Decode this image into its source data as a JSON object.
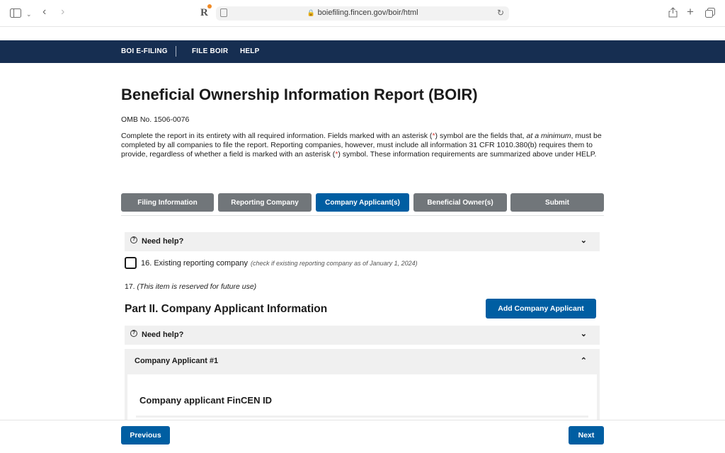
{
  "browser": {
    "url": "boiefiling.fincen.gov/boir/html"
  },
  "nav": {
    "items": [
      "BOI E-FILING",
      "FILE BOIR",
      "HELP"
    ]
  },
  "page": {
    "title": "Beneficial Ownership Information Report (BOIR)",
    "omb": "OMB No. 1506-0076",
    "desc_1": "Complete the report in its entirety with all required information. Fields marked with an asterisk (",
    "asterisk": "*",
    "desc_2": ") symbol are the fields that, ",
    "desc_em": "at a minimum",
    "desc_3": ", must be completed by all companies to file the report. Reporting companies, however, must include all information 31 CFR 1010.380(b) requires them to provide, regardless of whether a field is marked with an asterisk (",
    "desc_4": ") symbol. These information requirements are summarized above under HELP."
  },
  "steps": [
    {
      "label": "Filing Information",
      "active": false
    },
    {
      "label": "Reporting Company",
      "active": false
    },
    {
      "label": "Company Applicant(s)",
      "active": true
    },
    {
      "label": "Beneficial Owner(s)",
      "active": false
    },
    {
      "label": "Submit",
      "active": false
    }
  ],
  "help": {
    "label": "Need help?"
  },
  "field16": {
    "label": "16. Existing reporting company",
    "hint": "(check if existing reporting company as of January 1, 2024)",
    "checked": false
  },
  "field17": {
    "number": "17.",
    "text": "(This item is reserved for future use)"
  },
  "part2": {
    "title": "Part II. Company Applicant Information",
    "add_button": "Add Company Applicant"
  },
  "applicant": {
    "header": "Company Applicant #1",
    "fincen_title": "Company applicant FinCEN ID"
  },
  "footer": {
    "previous": "Previous",
    "next": "Next"
  },
  "colors": {
    "nav_bg": "#162e51",
    "primary": "#005ea2",
    "inactive_step": "#71767a",
    "required": "#d83933"
  }
}
